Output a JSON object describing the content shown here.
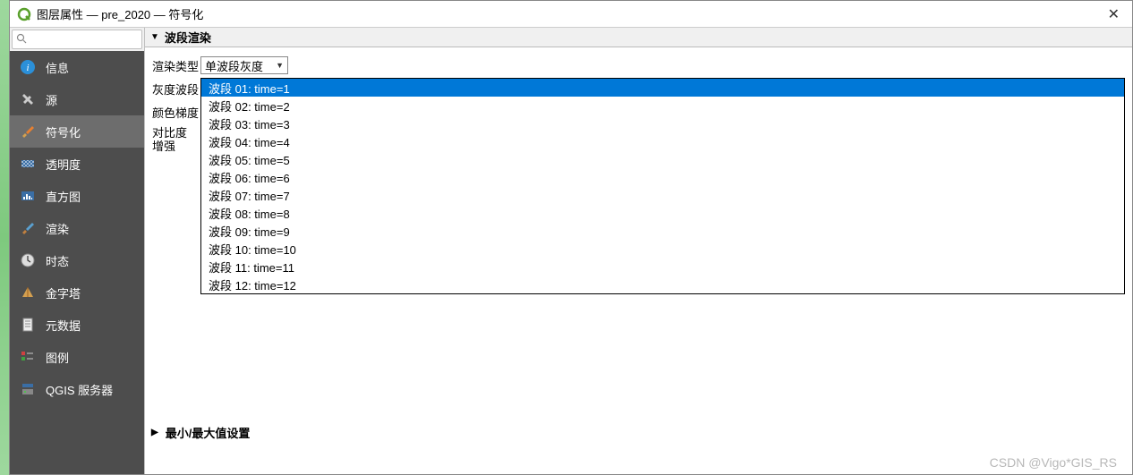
{
  "window": {
    "title": "图层属性 — pre_2020 — 符号化"
  },
  "sidebar": {
    "items": [
      {
        "label": "信息"
      },
      {
        "label": "源"
      },
      {
        "label": "符号化"
      },
      {
        "label": "透明度"
      },
      {
        "label": "直方图"
      },
      {
        "label": "渲染"
      },
      {
        "label": "时态"
      },
      {
        "label": "金字塔"
      },
      {
        "label": "元数据"
      },
      {
        "label": "图例"
      },
      {
        "label": "QGIS 服务器"
      }
    ]
  },
  "section1": {
    "title": "波段渲染"
  },
  "form": {
    "render_type_label": "渲染类型",
    "render_type_value": "单波段灰度",
    "gray_band_label": "灰度波段",
    "gradient_label": "颜色梯度",
    "contrast_label": "对比度\n增强"
  },
  "dropdown": {
    "options": [
      "波段 01: time=1",
      "波段 02: time=2",
      "波段 03: time=3",
      "波段 04: time=4",
      "波段 05: time=5",
      "波段 06: time=6",
      "波段 07: time=7",
      "波段 08: time=8",
      "波段 09: time=9",
      "波段 10: time=10",
      "波段 11: time=11",
      "波段 12: time=12"
    ]
  },
  "section2": {
    "title": "最小/最大值设置"
  },
  "watermark": "CSDN @Vigo*GIS_RS"
}
